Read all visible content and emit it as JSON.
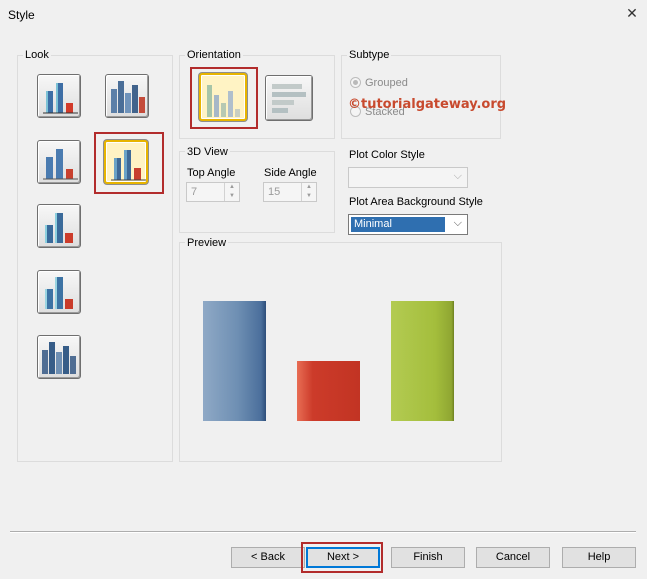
{
  "window": {
    "title": "Style",
    "close_label": "✕"
  },
  "look": {
    "label": "Look",
    "items": [
      {
        "name": "look-column-3d-flat",
        "selected": false
      },
      {
        "name": "look-column-3d-clustered",
        "selected": false
      },
      {
        "name": "look-column-3d-gradient",
        "selected": false
      },
      {
        "name": "look-column-3d-selected",
        "selected": true
      },
      {
        "name": "look-column-3d-tall",
        "selected": false
      },
      {
        "name": "look-column-3d-cylinder",
        "selected": false
      },
      {
        "name": "look-column-3d-stacked-depth",
        "selected": false
      }
    ]
  },
  "orientation": {
    "label": "Orientation",
    "options": [
      {
        "name": "vertical",
        "selected": true
      },
      {
        "name": "horizontal",
        "selected": false
      }
    ]
  },
  "subtype": {
    "label": "Subtype",
    "options": [
      {
        "label": "Grouped",
        "checked": true
      },
      {
        "label": "Stacked",
        "checked": false
      }
    ]
  },
  "view3d": {
    "label": "3D View",
    "top_angle_label": "Top Angle",
    "top_angle_value": "7",
    "side_angle_label": "Side Angle",
    "side_angle_value": "15"
  },
  "plot_color_style": {
    "label": "Plot Color Style",
    "value": ""
  },
  "plot_area_bg": {
    "label": "Plot Area Background Style",
    "value": "Minimal"
  },
  "preview": {
    "label": "Preview",
    "bars": [
      {
        "color": "#6e8fb3",
        "value": 1.0
      },
      {
        "color": "#cc3b2a",
        "value": 0.5
      },
      {
        "color": "#a4be3c",
        "value": 1.0
      }
    ]
  },
  "watermark": "©tutorialgateway.org",
  "buttons": {
    "back": "< Back",
    "next": "Next >",
    "finish": "Finish",
    "cancel": "Cancel",
    "help": "Help"
  },
  "colors": {
    "highlight": "#b22c2c",
    "selected_fill": "#fff3c4"
  }
}
